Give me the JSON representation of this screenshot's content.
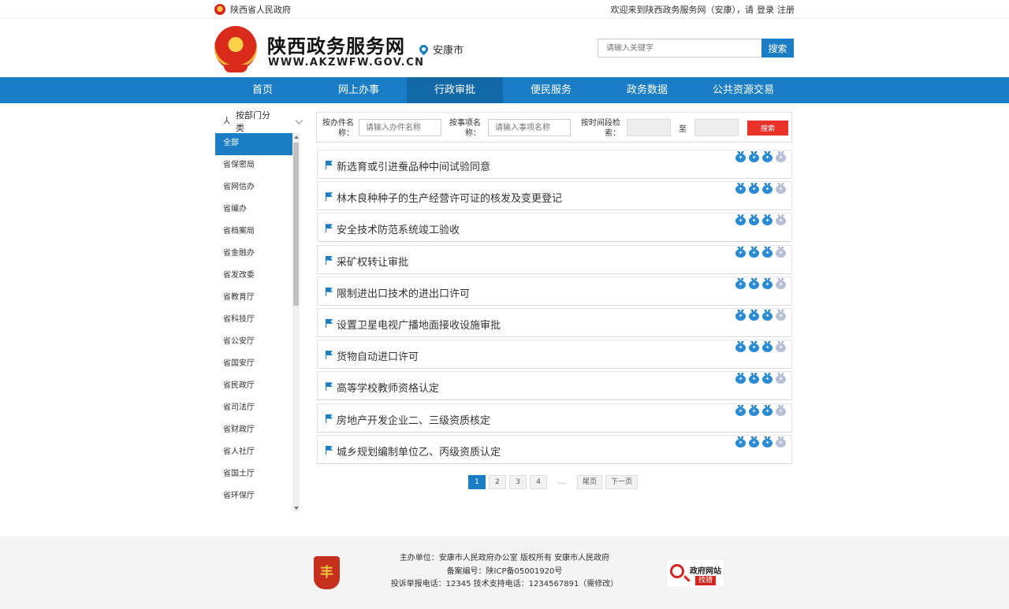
{
  "topbar": {
    "gov_name": "陕西省人民政府",
    "welcome": "欢迎来到陕西政务服务网（安康），请",
    "login": "登录",
    "register": "注册"
  },
  "header": {
    "title": "陕西政务服务网",
    "domain": "WWW.AKZWFW.GOV.CN",
    "city": "安康市",
    "search_placeholder": "请输入关键字",
    "search_button": "搜索"
  },
  "nav": {
    "items": [
      "首页",
      "网上办事",
      "行政审批",
      "便民服务",
      "政务数据",
      "公共资源交易"
    ],
    "active_index": 2
  },
  "sidebar": {
    "header": "按部门分类",
    "departments": [
      "全部",
      "省保密局",
      "省网信办",
      "省编办",
      "省档案局",
      "省金融办",
      "省发改委",
      "省教育厅",
      "省科技厅",
      "省公安厅",
      "省国安厅",
      "省民政厅",
      "省司法厅",
      "省财政厅",
      "省人社厅",
      "省国土厅",
      "省环保厅"
    ],
    "active_index": 0
  },
  "filter": {
    "label_name_1": "按办件名",
    "label_name_2": "称：",
    "name_placeholder": "请输入办件名称",
    "label_item_1": "按事项名",
    "label_item_2": "称：",
    "item_placeholder": "请输入事项名称",
    "label_time_1": "按时间段检",
    "label_time_2": "索：",
    "to": "至",
    "search_button": "搜索"
  },
  "items": [
    {
      "title": "新选育或引进蚕品种中间试验同意",
      "rating": 3
    },
    {
      "title": "林木良种种子的生产经营许可证的核发及变更登记",
      "rating": 3
    },
    {
      "title": "安全技术防范系统竣工验收",
      "rating": 3
    },
    {
      "title": "采矿权转让审批",
      "rating": 3
    },
    {
      "title": "限制进出口技术的进出口许可",
      "rating": 3
    },
    {
      "title": "设置卫星电视广播地面接收设施审批",
      "rating": 3
    },
    {
      "title": "货物自动进口许可",
      "rating": 3
    },
    {
      "title": "高等学校教师资格认定",
      "rating": 3
    },
    {
      "title": "房地产开发企业二、三级资质核定",
      "rating": 3
    },
    {
      "title": "城乡规划编制单位乙、丙级资质认定",
      "rating": 3
    }
  ],
  "rating_max": 4,
  "pager": {
    "pages": [
      "1",
      "2",
      "3",
      "4"
    ],
    "active": "1",
    "ellipsis": "...",
    "last": "尾页",
    "next": "下一页"
  },
  "footer": {
    "line1": "主办单位：安康市人民政府办公室    版权所有 安康市人民政府",
    "line2": "备案编号：陕ICP备05001920号",
    "line3": "投诉举报电话：12345   技术支持电话：1234567891（需修改）",
    "badge_title": "政府网站",
    "badge_sub": "找错"
  },
  "colors": {
    "primary": "#1a7dc5",
    "nav_active": "#1368a8",
    "danger": "#e8322a"
  }
}
